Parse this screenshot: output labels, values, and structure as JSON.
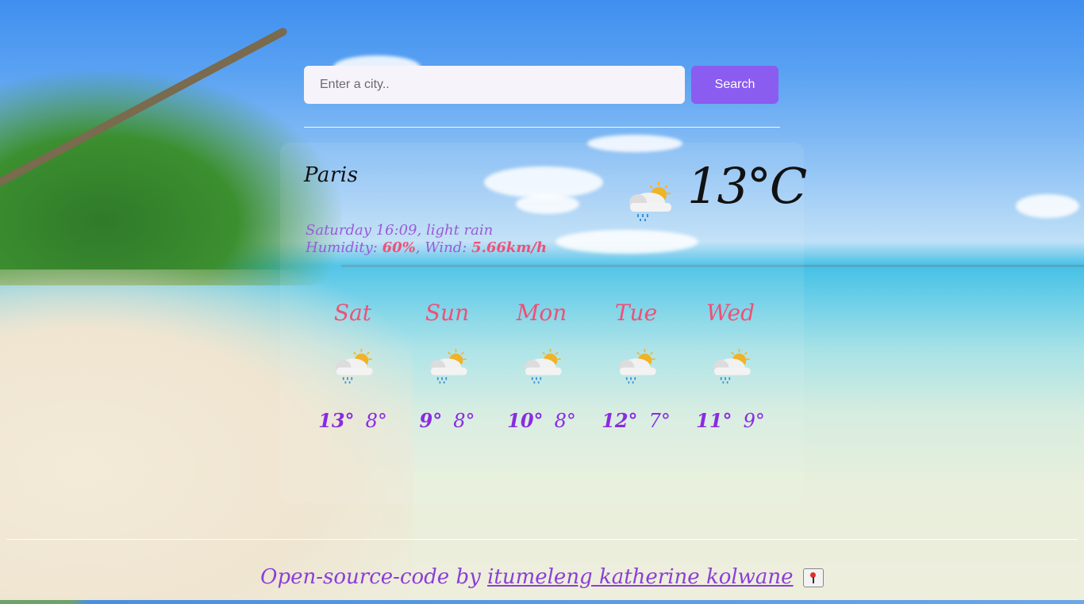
{
  "search": {
    "placeholder": "Enter a city..",
    "value": "",
    "button_label": "Search"
  },
  "current": {
    "city": "Paris",
    "day_time": "Saturday 16:09",
    "description": "light rain",
    "humidity_label": "Humidity:",
    "humidity": "60%",
    "wind_label": "Wind:",
    "wind": "5.66km/h",
    "temperature": "13",
    "unit": "°C",
    "icon": "rain-sun-cloud-icon"
  },
  "forecast": [
    {
      "day": "Sat",
      "max": "13°",
      "min": "8°",
      "icon": "rain-sun-cloud-icon"
    },
    {
      "day": "Sun",
      "max": "9°",
      "min": "8°",
      "icon": "rain-sun-cloud-icon"
    },
    {
      "day": "Mon",
      "max": "10°",
      "min": "8°",
      "icon": "rain-sun-cloud-icon"
    },
    {
      "day": "Tue",
      "max": "12°",
      "min": "7°",
      "icon": "rain-sun-cloud-icon"
    },
    {
      "day": "Wed",
      "max": "11°",
      "min": "9°",
      "icon": "rain-sun-cloud-icon"
    }
  ],
  "footer": {
    "prefix": "Open-source-code by ",
    "author_link": "itumeleng katherine kolwane",
    "pin_icon": "pushpin-icon"
  },
  "colors": {
    "accent_button": "#8b5cf0",
    "day_names": "#f05078",
    "temps": "#8a2be2",
    "details": "#9a5ad8",
    "highlight": "#f05078"
  }
}
